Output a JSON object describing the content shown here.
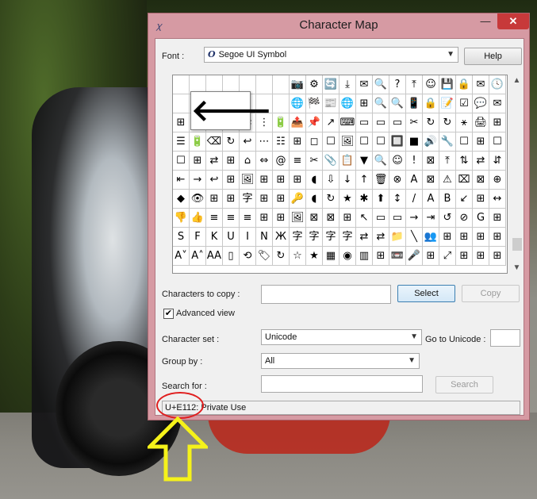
{
  "window": {
    "title": "Character Map",
    "minimize_glyph": "—",
    "close_glyph": "✕"
  },
  "font": {
    "label": "Font :",
    "value": "Segoe UI Symbol",
    "icon": "O",
    "help_button": "Help"
  },
  "grid": {
    "selected_char": "🡐",
    "rows": [
      [
        "",
        "",
        "",
        "",
        "",
        "",
        "",
        "📷",
        "⚙",
        "🔄",
        "⤓",
        "✉",
        "🔍",
        "?",
        "⤒",
        "☺",
        "💾",
        "🔒",
        "✉",
        "🕓"
      ],
      [
        "",
        "",
        "",
        "",
        "",
        "",
        "",
        "🌐",
        "🏁",
        "📰",
        "🌐",
        "⊞",
        "🔍",
        "🔍",
        "📱",
        "🔒",
        "📝",
        "☑",
        "💬",
        "✉"
      ],
      [
        "⊞",
        "📍",
        "📞",
        "💬",
        "⇄",
        "⋮",
        "🔋",
        "📤",
        "📌",
        "↗",
        "⌨",
        "▭",
        "▭",
        "▭",
        "✂",
        "↻",
        "↻",
        "⚹",
        "🖨",
        "⊞"
      ],
      [
        "☰",
        "🔋",
        "⌫",
        "↻",
        "↩",
        "⋯",
        "☷",
        "⊞",
        "◻",
        "☐",
        "🖼",
        "☐",
        "☐",
        "🔲",
        "■",
        "🔊",
        "🔧",
        "☐",
        "⊞",
        "☐"
      ],
      [
        "☐",
        "⊞",
        "⇄",
        "⊞",
        "⌂",
        "⇔",
        "@",
        "≡",
        "✂",
        "📎",
        "📋",
        "▼",
        "🔍",
        "☺",
        "!",
        "⊠",
        "⤒",
        "⇅",
        "⇄",
        "⇵"
      ],
      [
        "⇤",
        "→",
        "↩",
        "⊞",
        "🖼",
        "⊞",
        "⊞",
        "⊞",
        "◖",
        "⇩",
        "↓",
        "↑",
        "🗑",
        "⊗",
        "A",
        "⊠",
        "⚠",
        "⌧",
        "⊠",
        "⊕"
      ],
      [
        "◆",
        "👁",
        "⊞",
        "⊞",
        "字",
        "⊞",
        "⊞",
        "🔑",
        "◖",
        "↻",
        "★",
        "✱",
        "⬆",
        "↕",
        "/",
        "A",
        "B",
        "↙",
        "⊞",
        "↔"
      ],
      [
        "👎",
        "👍",
        "≡",
        "≡",
        "≡",
        "⊞",
        "⊞",
        "🖼",
        "⊠",
        "⊠",
        "⊞",
        "↖",
        "▭",
        "▭",
        "→",
        "⇥",
        "↺",
        "⊘",
        "G",
        "⊞"
      ],
      [
        "S",
        "F",
        "K",
        "U",
        "I",
        "N",
        "Ж",
        "字",
        "字",
        "字",
        "字",
        "⇄",
        "⇄",
        "📁",
        "╲",
        "👥",
        "⊞",
        "⊞",
        "⊞",
        "⊞"
      ],
      [
        "A˅",
        "A˄",
        "AA",
        "▯",
        "⟲",
        "🏷",
        "↻",
        "☆",
        "★",
        "▦",
        "◉",
        "▥",
        "⊞",
        "📼",
        "🎤",
        "⊞",
        "⤢",
        "⊞",
        "⊞",
        "⊞"
      ]
    ]
  },
  "copy": {
    "label": "Characters to copy :",
    "value": "",
    "select_button": "Select",
    "copy_button": "Copy"
  },
  "advanced": {
    "label": "Advanced view",
    "checked_glyph": "✔"
  },
  "character_set": {
    "label": "Character set :",
    "value": "Unicode",
    "goto_label": "Go to Unicode :",
    "goto_value": ""
  },
  "group_by": {
    "label": "Group by :",
    "value": "All"
  },
  "search": {
    "label": "Search for :",
    "value": "",
    "button": "Search"
  },
  "status": {
    "text": "U+E112: Private Use"
  },
  "annotation": {
    "circle_color": "#e01e1e",
    "arrow_color": "#f5f21a"
  }
}
